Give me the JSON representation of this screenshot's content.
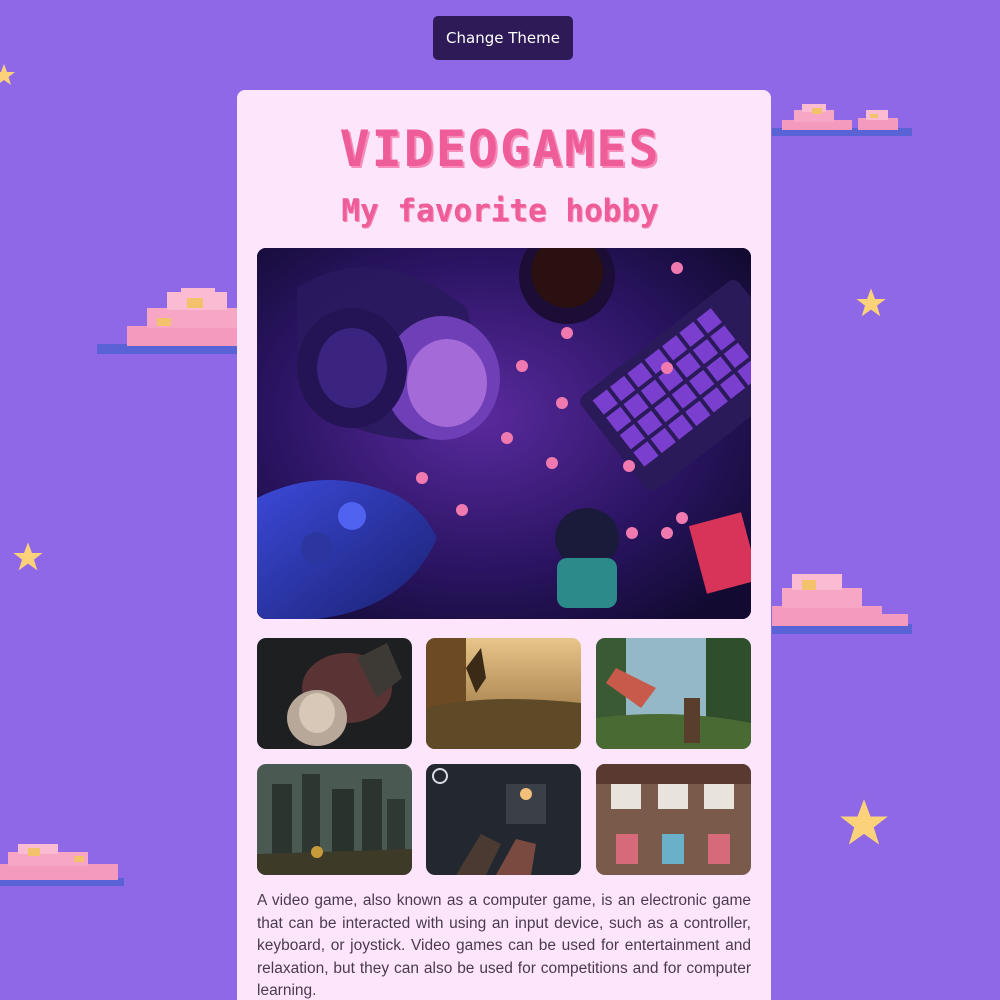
{
  "header": {
    "theme_button_label": "Change Theme"
  },
  "card": {
    "title": "VIDEOGAMES",
    "subtitle": "My favorite hobby",
    "description": "A video game, also known as a computer game, is an electronic game that can be interacted with using an input device, such as a controller, keyboard, or joystick. Video games can be used for entertainment and relaxation, but they can also be used for competitions and for computer learning."
  },
  "images": {
    "hero": "gaming-setup-photo",
    "gallery": [
      "horror-game-screenshot",
      "fantasy-valley-screenshot",
      "jungle-combat-screenshot",
      "gothic-castle-screenshot",
      "shooter-game-screenshot",
      "craft-puzzle-screenshot"
    ]
  },
  "colors": {
    "background": "#8e68e6",
    "card": "#fde6fb",
    "accent": "#ee5d97",
    "button": "#2e1a57",
    "star": "#fbd27a"
  }
}
